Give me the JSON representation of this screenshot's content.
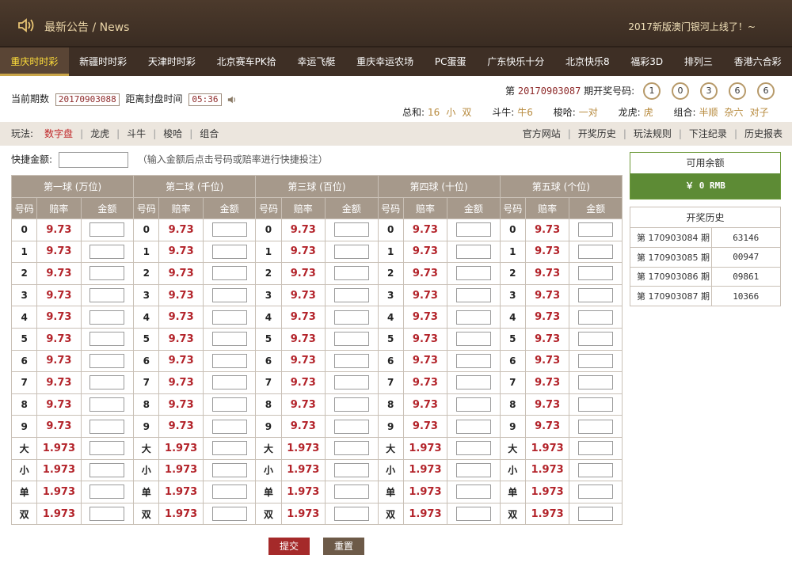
{
  "header": {
    "news_title": "最新公告 / News",
    "marquee": "2017新版澳门银河上线了！~"
  },
  "tabs": [
    "重庆时时彩",
    "新疆时时彩",
    "天津时时彩",
    "北京赛车PK拾",
    "幸运飞艇",
    "重庆幸运农场",
    "PC蛋蛋",
    "广东快乐十分",
    "北京快乐8",
    "福彩3D",
    "排列三",
    "香港六合彩"
  ],
  "active_tab": 0,
  "info": {
    "current_period_label": "当前期数",
    "current_period": "20170903088",
    "close_label": "距离封盘时间",
    "countdown": "05:36",
    "draw_prefix": "第",
    "draw_period": "20170903087",
    "draw_suffix": "期开奖号码:",
    "balls": [
      "1",
      "0",
      "3",
      "6",
      "6"
    ],
    "stats": {
      "sum_label": "总和:",
      "sum_value": "16",
      "sum_size": "小",
      "sum_parity": "双",
      "douniu_label": "斗牛:",
      "douniu_value": "牛6",
      "suoha_label": "梭哈:",
      "suoha_value": "一对",
      "longhu_label": "龙虎:",
      "longhu_value": "虎",
      "combo_label": "组合:",
      "combo_values": [
        "半顺",
        "杂六",
        "对子"
      ]
    }
  },
  "playbar": {
    "play_label": "玩法:",
    "modes": [
      "数字盘",
      "龙虎",
      "斗牛",
      "梭哈",
      "组合"
    ],
    "active_mode": 0,
    "links": [
      "官方网站",
      "开奖历史",
      "玩法规则",
      "下注纪录",
      "历史报表"
    ]
  },
  "quick": {
    "label": "快捷金额:",
    "value": "",
    "hint": "（输入金额后点击号码或赔率进行快捷投注）"
  },
  "table": {
    "groups": [
      "第一球 (万位)",
      "第二球 (千位)",
      "第三球 (百位)",
      "第四球 (十位)",
      "第五球 (个位)"
    ],
    "sub_headers": [
      "号码",
      "赔率",
      "金额"
    ],
    "rows": [
      {
        "num": "0",
        "odds": "9.73"
      },
      {
        "num": "1",
        "odds": "9.73"
      },
      {
        "num": "2",
        "odds": "9.73"
      },
      {
        "num": "3",
        "odds": "9.73"
      },
      {
        "num": "4",
        "odds": "9.73"
      },
      {
        "num": "5",
        "odds": "9.73"
      },
      {
        "num": "6",
        "odds": "9.73"
      },
      {
        "num": "7",
        "odds": "9.73"
      },
      {
        "num": "8",
        "odds": "9.73"
      },
      {
        "num": "9",
        "odds": "9.73"
      },
      {
        "num": "大",
        "odds": "1.973"
      },
      {
        "num": "小",
        "odds": "1.973"
      },
      {
        "num": "单",
        "odds": "1.973"
      },
      {
        "num": "双",
        "odds": "1.973"
      }
    ]
  },
  "buttons": {
    "submit": "提交",
    "reset": "重置"
  },
  "balance": {
    "title": "可用余额",
    "value": "￥ 0 RMB"
  },
  "history": {
    "title": "开奖历史",
    "rows": [
      {
        "period": "第 170903084 期",
        "result": "63146"
      },
      {
        "period": "第 170903085 期",
        "result": "00947"
      },
      {
        "period": "第 170903086 期",
        "result": "09861"
      },
      {
        "period": "第 170903087 期",
        "result": "10366"
      }
    ]
  },
  "colors": {
    "header_bg": "#3e2f25",
    "active_tab_text": "#ffde3a",
    "odds_red": "#b3232a",
    "table_header": "#a6998b",
    "balance_green": "#5d8b35",
    "submit_red": "#a52a2a",
    "reset_brown": "#6d5a48"
  }
}
